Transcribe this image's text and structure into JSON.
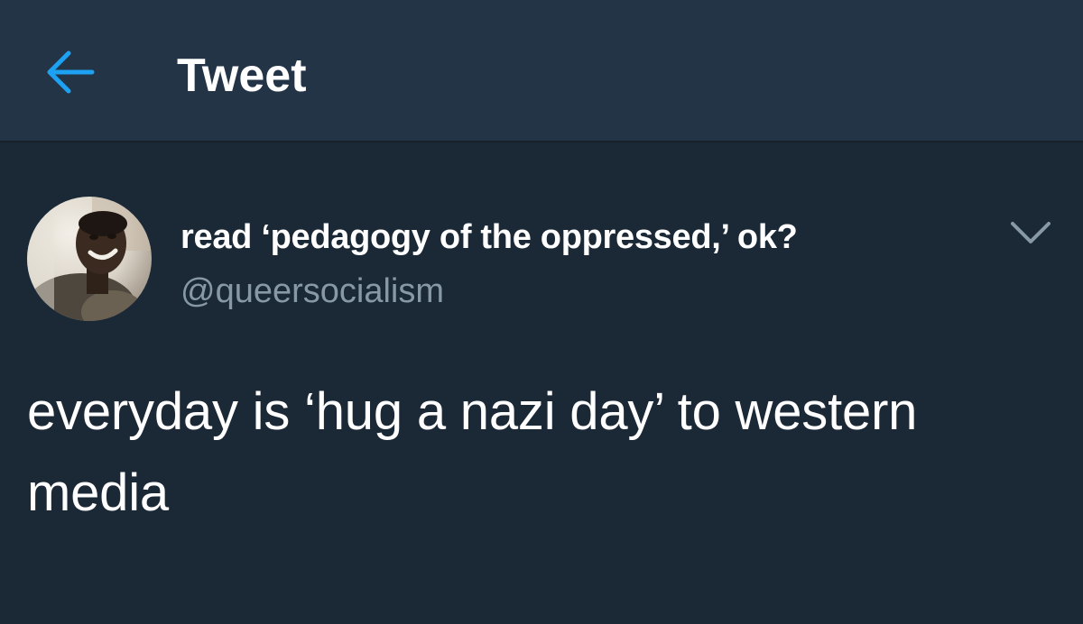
{
  "header": {
    "title": "Tweet",
    "back_icon": "arrow-left-icon"
  },
  "tweet": {
    "author": {
      "display_name": "read ‘pedagogy of the oppressed,’ ok?",
      "handle": "@queersocialism"
    },
    "menu_icon": "chevron-down-icon",
    "text": "everyday is ‘hug a nazi day’ to western media"
  },
  "colors": {
    "background": "#1b2836",
    "header_background": "#243447",
    "accent": "#1da1f2",
    "secondary_text": "#8899a6",
    "primary_text": "#ffffff"
  }
}
